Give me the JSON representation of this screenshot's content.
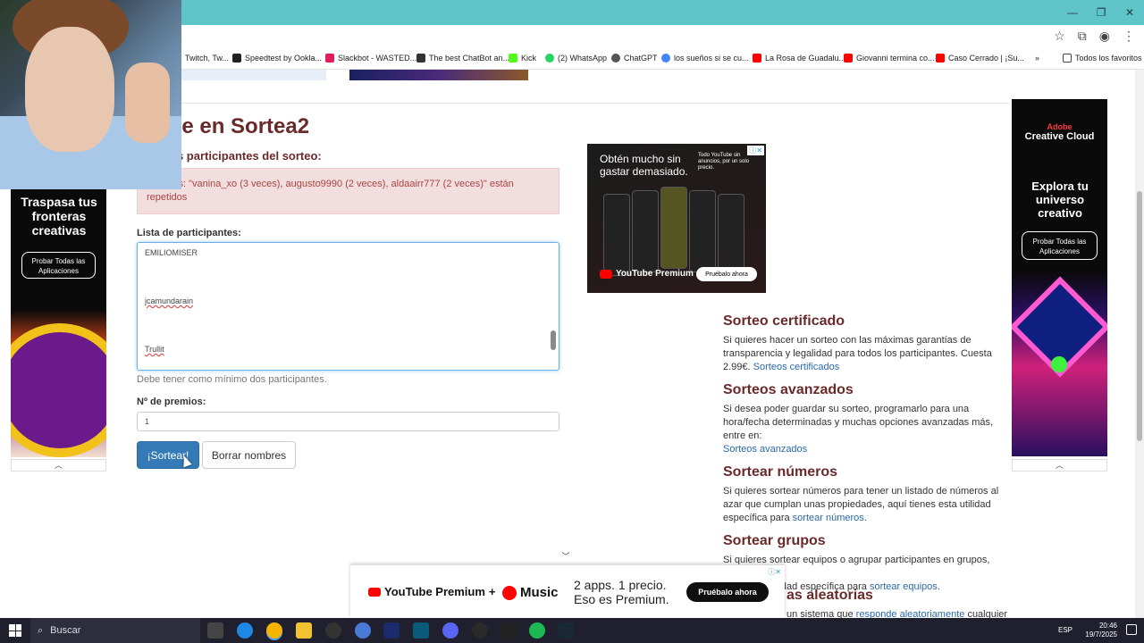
{
  "browser": {
    "controls": [
      "—",
      "❐",
      "✕"
    ],
    "bookmarks": [
      "Twitch, Tw...",
      "Speedtest by Ookla...",
      "Slackbot - WASTED...",
      "The best ChatBot an...",
      "Kick",
      "(2) WhatsApp",
      "ChatGPT",
      "los sueños si se cu...",
      "La Rosa de Guadalu...",
      "Giovanni termina co...",
      "Caso Cerrado | ¡Su...",
      "»",
      "Todos los favoritos"
    ]
  },
  "page": {
    "title": "ee en Sortea2",
    "subtitle": "os participantes del sorteo:",
    "alert": "cipantes: \"vanina_xo (3 veces), augusto9990 (2 veces), aldaairr777 (2 veces)\" están repetidos",
    "participants_label": "Lista de participantes:",
    "participants": [
      "EMILIOMISER",
      "jcamundarain",
      "Trullit"
    ],
    "participants_help": "Debe tener como mínimo dos participantes.",
    "prizes_label": "Nº de premios:",
    "prizes_value": "1",
    "draw_button": "¡Sortear!",
    "clear_button": "Borrar nombres"
  },
  "sidebar": {
    "certified_title": "Sorteo certificado",
    "certified_text": "Si quieres hacer un sorteo con las máximas garantías de transparencia y legalidad para todos los participantes. Cuesta 2.99€.",
    "certified_link": "Sorteos certificados",
    "advanced_title": "Sorteos avanzados",
    "advanced_text": "Si desea poder guardar su sorteo, programarlo para una hora/fecha determinadas y muchas opciones avanzadas más, entre en:",
    "advanced_link": "Sorteos avanzados",
    "numbers_title": "Sortear números",
    "numbers_text": "Si quieres sortear números para tener un listado de números al azar que cumplan unas propiedades, aquí tienes esta utilidad específica para",
    "numbers_link": "sortear números",
    "groups_title": "Sortear grupos",
    "groups_text_1": "Si quieres sortear equipos o agrupar participantes en grupos, aquí",
    "groups_text_2": "lidad específica para",
    "groups_link": "sortear equipos",
    "random_title": "as aleatorias",
    "random_text": "un sistema que",
    "random_link": "responde aleatoriamente",
    "random_tail": "cualquier"
  },
  "ads": {
    "yt_headline": "Obtén mucho sin gastar demasiado.",
    "yt_side": "Todo YouTube sin anuncios, por un solo precio.",
    "yt_brand": "YouTube Premium",
    "yt_cta": "Pruébalo ahora",
    "left_headline": "Traspasa tus fronteras creativas",
    "left_cta": "Probar Todas las Aplicaciones",
    "right_logo_1": "Adobe",
    "right_logo_2": "Creative Cloud",
    "right_headline": "Explora tu universo creativo",
    "right_cta": "Probar Todas las Aplicaciones",
    "banner_brand_1": "YouTube Premium",
    "banner_plus": "+",
    "banner_brand_2": "Music",
    "banner_msg_1": "2 apps. 1 precio.",
    "banner_msg_2": "Eso es Premium.",
    "banner_cta": "Pruébalo ahora"
  },
  "taskbar": {
    "search_placeholder": "Buscar",
    "language": "ESP",
    "time": "20:46",
    "date": "19/7/2025"
  },
  "colors": {
    "title": "#6b2a2a",
    "link": "#2a6aa8",
    "primary_button": "#337ab7",
    "titlebar": "#5fc4c8"
  }
}
